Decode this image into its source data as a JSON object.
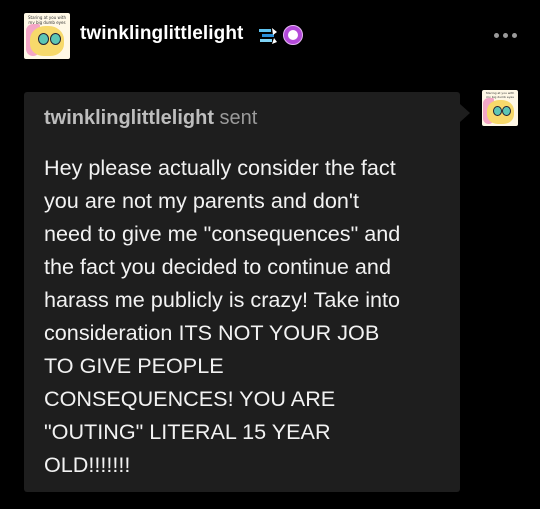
{
  "header": {
    "avatar_caption": "Staring at you with my big dumb eyes",
    "username": "twinklinglittlelight",
    "badge_icons": [
      "snowflake-badge-icon",
      "purple-paw-badge-icon"
    ],
    "more_icon": "ellipsis-icon"
  },
  "message": {
    "sender_name": "twinklinglittlelight",
    "sender_verb": "sent",
    "lines": [
      "Hey please actually consider the fact",
      "you are not my parents and don't",
      "need to give me \"consequences\" and",
      "the fact you decided to continue and",
      "harass me publicly is crazy!  Take into",
      "consideration ITS NOT YOUR JOB",
      "TO GIVE PEOPLE",
      "CONSEQUENCES! YOU ARE",
      "\"OUTING\" LITERAL 15 YEAR",
      "OLD!!!!!!!"
    ],
    "recipient_avatar_caption": "Staring at you with my big dumb eyes"
  },
  "colors": {
    "background": "#000000",
    "card": "#1e1e1e",
    "text": "#f2f2f2",
    "sender_text": "#b8b8b8",
    "badge_purple": "#b44ad9"
  }
}
